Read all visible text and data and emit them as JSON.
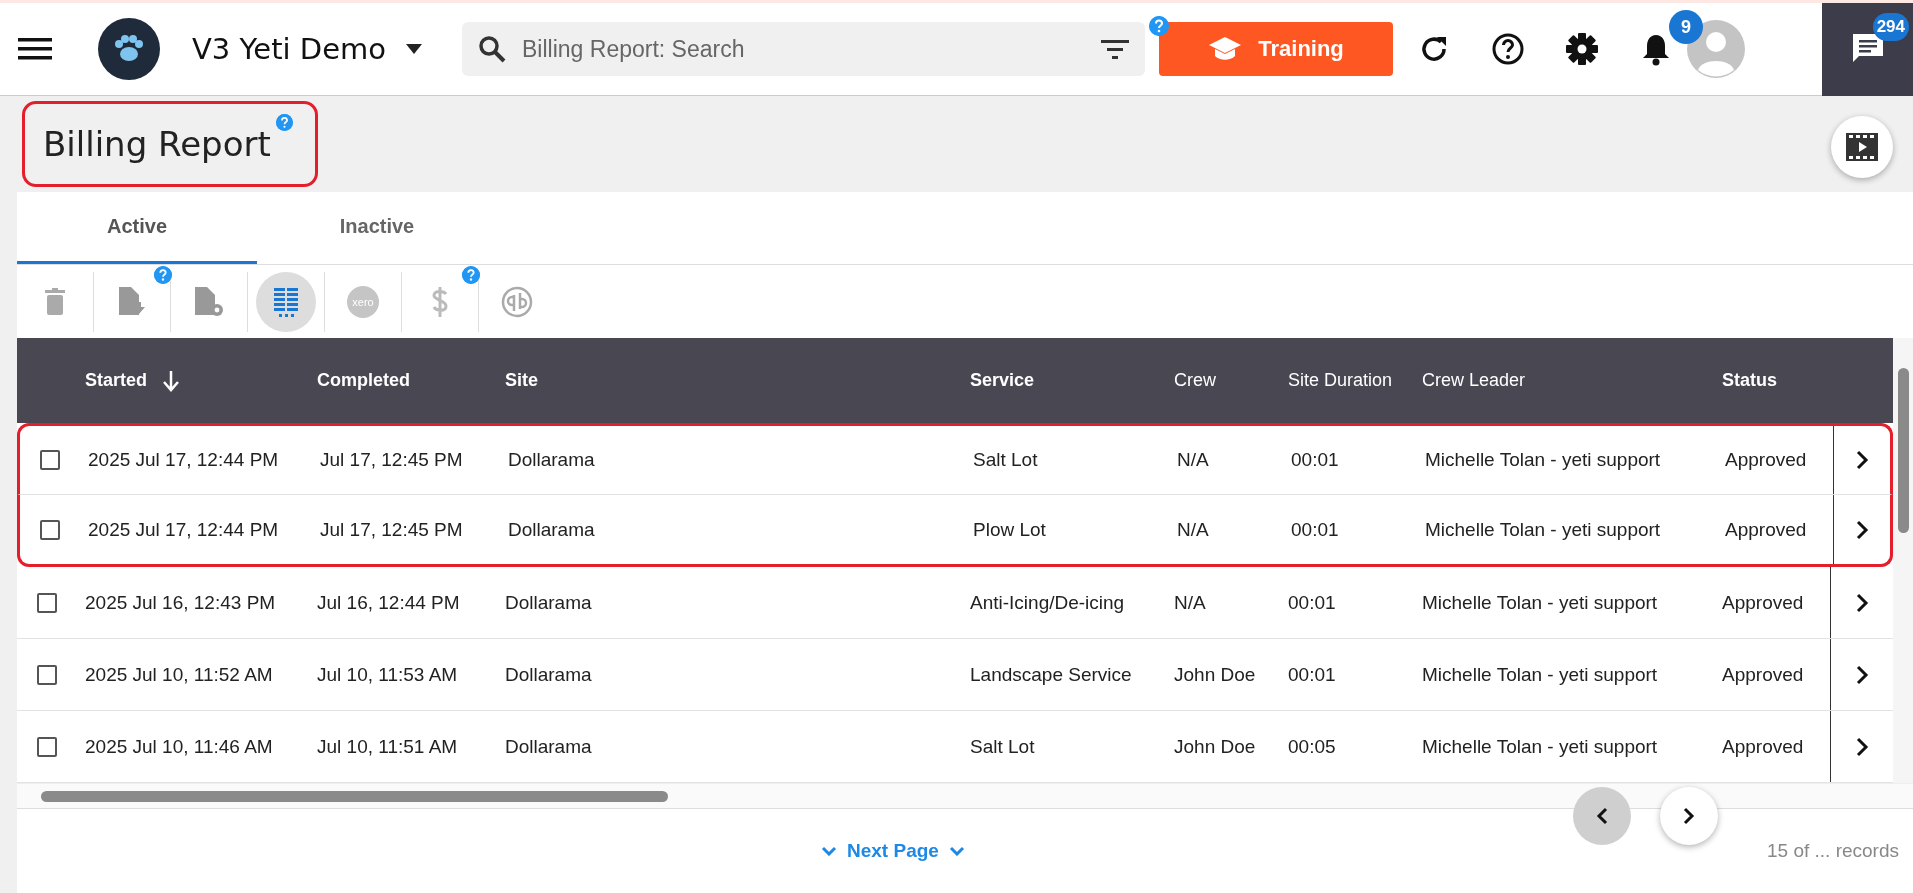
{
  "topbar": {
    "company": "V3 Yeti Demo",
    "search": {
      "placeholder": "Billing Report: Search"
    },
    "training_button": "Training",
    "notification_count": "9",
    "chat_count": "294"
  },
  "page": {
    "title": "Billing Report",
    "annotated": true
  },
  "tabs": [
    {
      "label": "Active",
      "selected": true
    },
    {
      "label": "Inactive",
      "selected": false
    }
  ],
  "toolbar": [
    {
      "kind": "delete",
      "help_badge": false,
      "selected": false
    },
    {
      "kind": "export",
      "help_badge": true,
      "selected": false
    },
    {
      "kind": "export-settings",
      "help_badge": false,
      "selected": false
    },
    {
      "kind": "columns",
      "help_badge": false,
      "selected": true
    },
    {
      "kind": "xero",
      "label": "xero",
      "help_badge": false,
      "selected": false
    },
    {
      "kind": "dollar",
      "help_badge": true,
      "selected": false
    },
    {
      "kind": "quickbooks",
      "help_badge": false,
      "selected": false
    }
  ],
  "table": {
    "columns": [
      {
        "label": "Started",
        "sortable": true,
        "sorted_descending": true
      },
      {
        "label": "Completed",
        "sortable": true
      },
      {
        "label": "Site",
        "sortable": true
      },
      {
        "label": "Service",
        "sortable": true
      },
      {
        "label": "Crew",
        "sortable": false
      },
      {
        "label": "Site Duration",
        "sortable": false
      },
      {
        "label": "Crew Leader",
        "sortable": false
      },
      {
        "label": "Status",
        "sortable": true
      }
    ],
    "rows": [
      {
        "checked": false,
        "annotated": true,
        "cells": [
          "2025 Jul 17, 12:44 PM",
          "Jul 17, 12:45 PM",
          "Dollarama",
          "Salt Lot",
          "N/A",
          "00:01",
          "Michelle Tolan - yeti support",
          "Approved"
        ]
      },
      {
        "checked": false,
        "annotated": true,
        "cells": [
          "2025 Jul 17, 12:44 PM",
          "Jul 17, 12:45 PM",
          "Dollarama",
          "Plow Lot",
          "N/A",
          "00:01",
          "Michelle Tolan - yeti support",
          "Approved"
        ]
      },
      {
        "checked": false,
        "annotated": false,
        "cells": [
          "2025 Jul 16, 12:43 PM",
          "Jul 16, 12:44 PM",
          "Dollarama",
          "Anti-Icing/De-icing",
          "N/A",
          "00:01",
          "Michelle Tolan - yeti support",
          "Approved"
        ]
      },
      {
        "checked": false,
        "annotated": false,
        "cells": [
          "2025 Jul 10, 11:52 AM",
          "Jul 10, 11:53 AM",
          "Dollarama",
          "Landscape Service",
          "John Doe",
          "00:01",
          "Michelle Tolan - yeti support",
          "Approved"
        ]
      },
      {
        "checked": false,
        "annotated": false,
        "cells": [
          "2025 Jul 10, 11:46 AM",
          "Jul 10, 11:51 AM",
          "Dollarama",
          "Salt Lot",
          "John Doe",
          "00:05",
          "Michelle Tolan - yeti support",
          "Approved"
        ]
      }
    ]
  },
  "footer": {
    "next_page": "Next Page",
    "records": "15 of ... records"
  }
}
